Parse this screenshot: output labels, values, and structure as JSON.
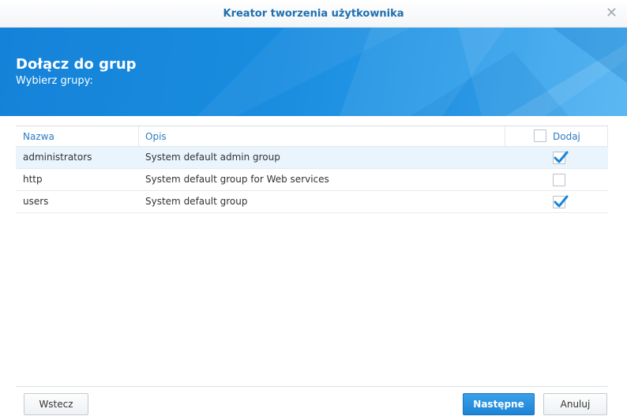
{
  "window": {
    "title": "Kreator tworzenia użytkownika"
  },
  "header": {
    "title": "Dołącz do grup",
    "subtitle": "Wybierz grupy:"
  },
  "table": {
    "columns": {
      "name": "Nazwa",
      "description": "Opis",
      "add": "Dodaj"
    },
    "select_all_checked": false,
    "rows": [
      {
        "name": "administrators",
        "description": "System default admin group",
        "checked": true,
        "selected": true
      },
      {
        "name": "http",
        "description": "System default group for Web services",
        "checked": false,
        "selected": false
      },
      {
        "name": "users",
        "description": "System default group",
        "checked": true,
        "selected": false
      }
    ]
  },
  "buttons": {
    "back": "Wstecz",
    "next": "Następne",
    "cancel": "Anuluj"
  },
  "colors": {
    "accent": "#1d84d6",
    "banner": "#1a8de0",
    "title": "#1d6fb0"
  }
}
